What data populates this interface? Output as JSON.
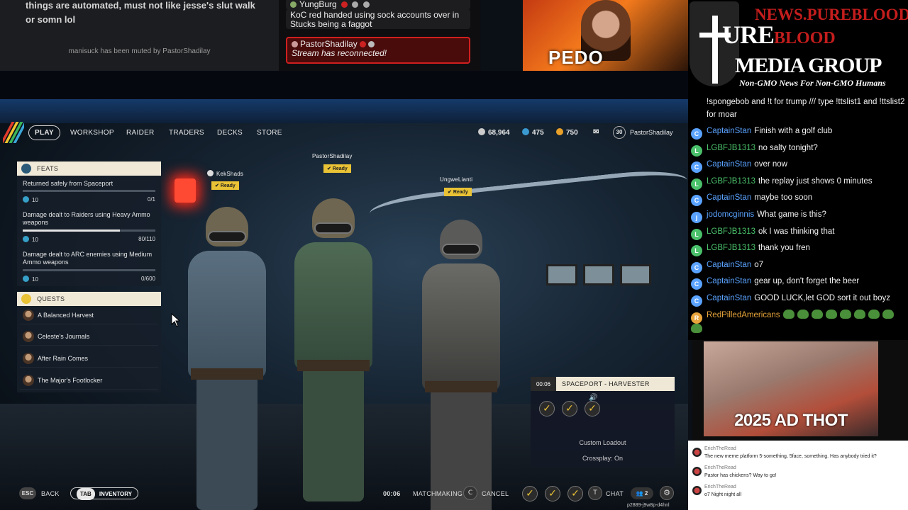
{
  "top_left": {
    "message": "things are automated, must not like jesse's slut walk or somn lol",
    "muted_notice": "manisuck has been muted by PastorShadilay"
  },
  "top_chat": {
    "items": [
      {
        "user": "YungBurg",
        "text": ""
      },
      {
        "user": "",
        "text": "KoC red handed using sock accounts over in Stucks being a faggot"
      },
      {
        "user": "PastorShadilay",
        "text": "Stream has reconnected!"
      }
    ]
  },
  "top_thumb": {
    "caption": "PEDO"
  },
  "game": {
    "nav": {
      "items": [
        "PLAY",
        "WORKSHOP",
        "RAIDER",
        "TRADERS",
        "DECKS",
        "STORE"
      ],
      "currencies": [
        "68,964",
        "475",
        "750"
      ],
      "level": "30",
      "username": "PastorShadilay"
    },
    "feats": {
      "title": "FEATS",
      "items": [
        {
          "label": "Returned safely from Spaceport",
          "points": "10",
          "progress": "0/1",
          "fraction": 0
        },
        {
          "label": "Damage dealt to Raiders using Heavy Ammo weapons",
          "points": "10",
          "progress": "80/110",
          "fraction": 0.73
        },
        {
          "label": "Damage dealt to ARC enemies using Medium Ammo weapons",
          "points": "10",
          "progress": "0/600",
          "fraction": 0
        }
      ]
    },
    "quests": {
      "title": "QUESTS",
      "items": [
        "A Balanced Harvest",
        "Celeste's Journals",
        "After Rain Comes",
        "The Major's Footlocker"
      ]
    },
    "players": [
      {
        "name": "KekShads",
        "status": "Ready"
      },
      {
        "name": "PastorShadilay",
        "status": "Ready"
      },
      {
        "name": "UngweLianti",
        "status": "Ready"
      }
    ],
    "spaceport": {
      "timer": "00:06",
      "title": "SPACEPORT - HARVESTER",
      "loadout": "Custom Loadout",
      "crossplay": "Crossplay: On"
    },
    "bottom": {
      "esc_key": "ESC",
      "back": "BACK",
      "tab_key": "TAB",
      "inventory": "INVENTORY",
      "timer": "00:06",
      "matchmaking": "MATCHMAKING",
      "cancel_key": "C",
      "cancel": "CANCEL",
      "chat_key": "T",
      "chat": "CHAT",
      "party_count": "2",
      "code": "p2889-j9w8p-d4hnl"
    }
  },
  "logo": {
    "url": "NEWS.PUREBLOOD.MEDIA",
    "line1a": "URE",
    "line1b": "BLOOD",
    "line2": "MEDIA GROUP",
    "tagline": "Non-GMO News For Non-GMO Humans"
  },
  "chat": {
    "header_text": "!spongebob and !t for trump /// type !ttslist1 and !ttslist2 for moar",
    "messages": [
      {
        "user": "CaptainStan",
        "text": "Finish with a golf club",
        "color": "#5aa2ff",
        "initial": "C"
      },
      {
        "user": "LGBFJB1313",
        "text": "no salty tonight?",
        "color": "#4ac06a",
        "initial": "L"
      },
      {
        "user": "CaptainStan",
        "text": "over now",
        "color": "#5aa2ff",
        "initial": "C"
      },
      {
        "user": "LGBFJB1313",
        "text": "the replay just shows 0 minutes",
        "color": "#4ac06a",
        "initial": "L"
      },
      {
        "user": "CaptainStan",
        "text": "maybe too soon",
        "color": "#5aa2ff",
        "initial": "C"
      },
      {
        "user": "jodomcginnis",
        "text": "What game is this?",
        "color": "#5aa2ff",
        "initial": "j"
      },
      {
        "user": "LGBFJB1313",
        "text": "ok I was thinking that",
        "color": "#4ac06a",
        "initial": "L"
      },
      {
        "user": "LGBFJB1313",
        "text": "thank you fren",
        "color": "#4ac06a",
        "initial": "L"
      },
      {
        "user": "CaptainStan",
        "text": "o7",
        "color": "#5aa2ff",
        "initial": "C"
      },
      {
        "user": "CaptainStan",
        "text": "gear up, don't forget the beer",
        "color": "#5aa2ff",
        "initial": "C"
      },
      {
        "user": "CaptainStan",
        "text": "GOOD LUCK,let GOD sort it out boyz",
        "color": "#5aa2ff",
        "initial": "C"
      },
      {
        "user": "RedPilledAmericans",
        "text": "",
        "color": "#e8a43a",
        "initial": "R"
      }
    ]
  },
  "ad": {
    "caption": "2025 AD THOT"
  },
  "mini_chat": [
    {
      "user": "ErichTheRead",
      "text": "The new meme platform 5-something, 5face, something. Has anybody tried it?"
    },
    {
      "user": "ErichTheRead",
      "text": "Pastor has chickens? Way to go!"
    },
    {
      "user": "ErichTheRead",
      "text": "o7 Night night all"
    }
  ],
  "colors": {
    "accent_yellow": "#e9c235",
    "chat_red": "#d11f1f",
    "logo_red": "#c41d1d"
  }
}
